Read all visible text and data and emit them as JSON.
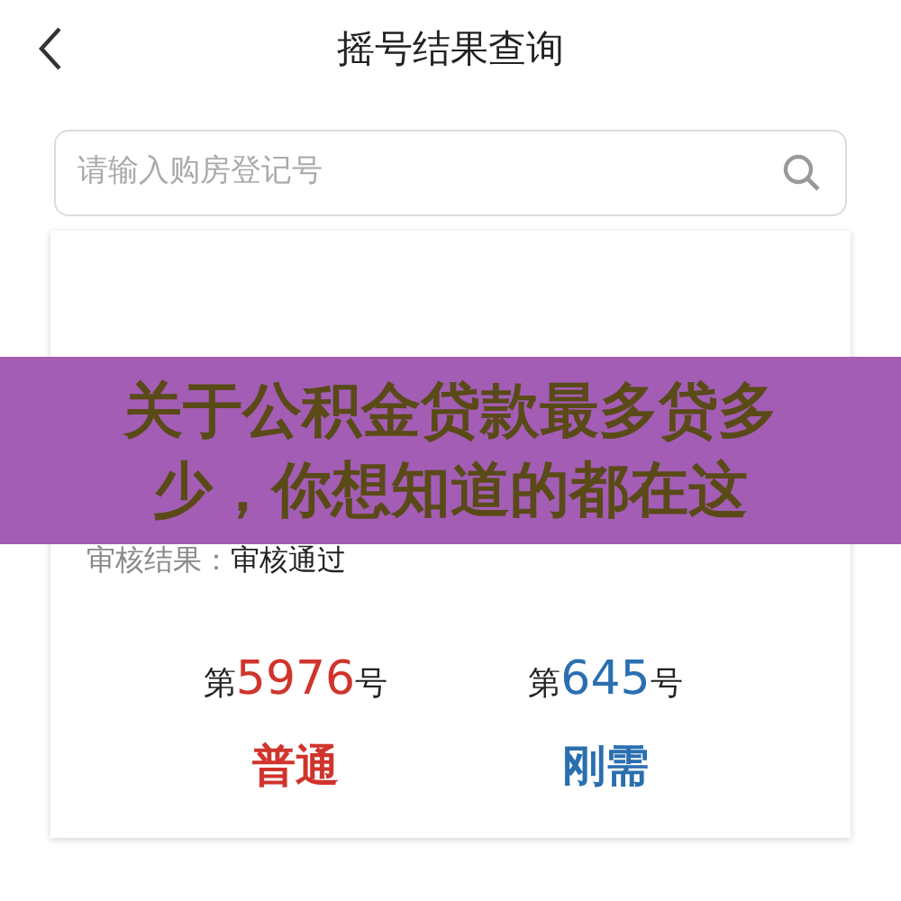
{
  "header": {
    "title": "摇号结果查询"
  },
  "search": {
    "placeholder": "请输入购房登记号"
  },
  "details": [
    {
      "label": "审核结果：",
      "value": "审核通过"
    }
  ],
  "results": [
    {
      "prefix": "第",
      "number": "5976",
      "suffix": "号",
      "category": "普通",
      "color": "#d0342c"
    },
    {
      "prefix": "第",
      "number": "645",
      "suffix": "号",
      "category": "刚需",
      "color": "#2a6fb0"
    }
  ],
  "banner": {
    "text": "关于公积金贷款最多贷多少，你想知道的都在这"
  }
}
